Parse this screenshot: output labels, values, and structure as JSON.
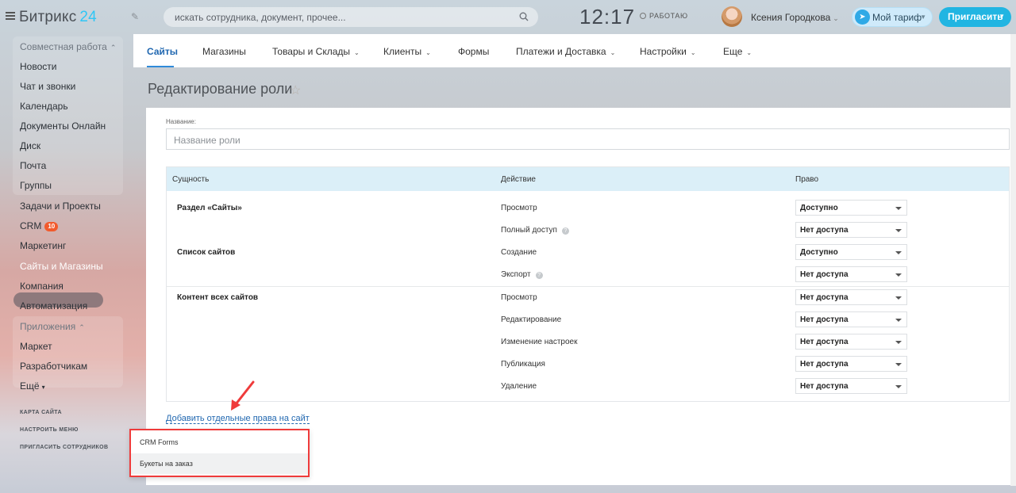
{
  "header": {
    "logo_text": "Битрикс",
    "logo_number": "24",
    "search_placeholder": "искать сотрудника, документ, прочее...",
    "time": "12:17",
    "work_status": "РАБОТАЮ",
    "user_name": "Ксения Городкова",
    "tariff_label": "Мой тариф",
    "invite_label": "Пригласить"
  },
  "sidebar": {
    "group1_title": "Совместная работа",
    "group1_items": [
      "Новости",
      "Чат и звонки",
      "Календарь",
      "Документы Онлайн",
      "Диск",
      "Почта",
      "Группы"
    ],
    "items": [
      "Задачи и Проекты",
      "CRM",
      "Маркетинг",
      "Сайты и Магазины",
      "Компания",
      "Автоматизация"
    ],
    "crm_badge": "10",
    "group2_title": "Приложения",
    "group2_items": [
      "Маркет",
      "Разработчикам"
    ],
    "more_label": "Ещё",
    "small_links": [
      "КАРТА САЙТА",
      "НАСТРОИТЬ МЕНЮ",
      "ПРИГЛАСИТЬ СОТРУДНИКОВ"
    ]
  },
  "tabs": [
    "Сайты",
    "Магазины",
    "Товары и Склады",
    "Клиенты",
    "Формы",
    "Платежи и Доставка",
    "Настройки",
    "Еще"
  ],
  "page": {
    "title": "Редактирование роли",
    "name_label": "Название:",
    "name_placeholder": "Название роли"
  },
  "table": {
    "headers": [
      "Сущность",
      "Действие",
      "Право"
    ],
    "groups": [
      {
        "entity": "Раздел «Сайты»",
        "rows": [
          {
            "action": "Просмотр",
            "right": "Доступно",
            "hint": false
          },
          {
            "action": "Полный доступ",
            "right": "Нет доступа",
            "hint": true
          }
        ]
      },
      {
        "entity": "Список сайтов",
        "rows": [
          {
            "action": "Создание",
            "right": "Доступно",
            "hint": false
          },
          {
            "action": "Экспорт",
            "right": "Нет доступа",
            "hint": true
          }
        ]
      },
      {
        "entity": "Контент всех сайтов",
        "rows": [
          {
            "action": "Просмотр",
            "right": "Нет доступа",
            "hint": false
          },
          {
            "action": "Редактирование",
            "right": "Нет доступа",
            "hint": false
          },
          {
            "action": "Изменение настроек",
            "right": "Нет доступа",
            "hint": false
          },
          {
            "action": "Публикация",
            "right": "Нет доступа",
            "hint": false
          },
          {
            "action": "Удаление",
            "right": "Нет доступа",
            "hint": false
          }
        ]
      }
    ]
  },
  "add_link": "Добавить отдельные права на сайт",
  "dropdown_items": [
    "CRM Forms",
    "Букеты на заказ"
  ],
  "colors": {
    "accent": "#2fc6f6",
    "invite": "#21b5e2",
    "link": "#2067b0",
    "highlight_box": "#ef3b3b",
    "badge": "#f25a2c"
  }
}
